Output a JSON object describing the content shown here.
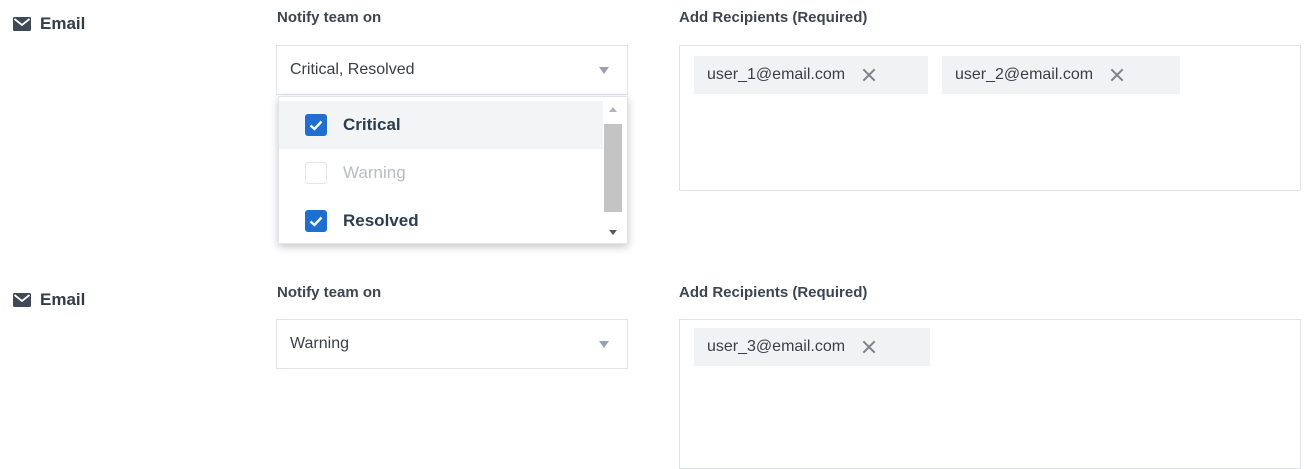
{
  "rows": [
    {
      "channel": {
        "label": "Email",
        "icon": "mail-icon"
      },
      "notify": {
        "label": "Notify team on",
        "selected": "Critical, Resolved",
        "dropdown_open": true,
        "options": [
          {
            "label": "Critical",
            "checked": true,
            "disabled": false
          },
          {
            "label": "Warning",
            "checked": false,
            "disabled": true
          },
          {
            "label": "Resolved",
            "checked": true,
            "disabled": false
          }
        ]
      },
      "recipients": {
        "label": "Add Recipients (Required)",
        "chips": [
          "user_1@email.com",
          "user_2@email.com"
        ]
      }
    },
    {
      "channel": {
        "label": "Email",
        "icon": "mail-icon"
      },
      "notify": {
        "label": "Notify team on",
        "selected": "Warning",
        "dropdown_open": false
      },
      "recipients": {
        "label": "Add Recipients (Required)",
        "chips": [
          "user_3@email.com"
        ]
      }
    }
  ],
  "colors": {
    "checkbox_checked": "#1e6fd0",
    "chip_background": "#f1f2f4",
    "border": "#dfe3e7"
  }
}
